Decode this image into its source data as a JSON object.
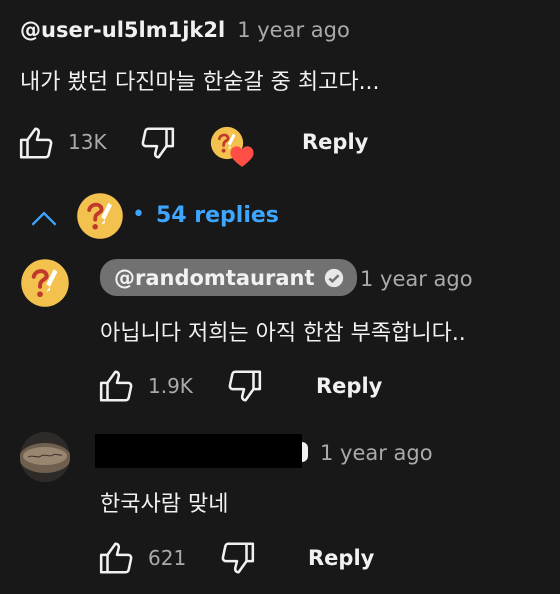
{
  "top_comment": {
    "author": "@user-ul5lm1jk2l",
    "timestamp": "1 year ago",
    "text": "내가 봤던 다진마늘 한숟갈 중 최고다...",
    "likes": "13K",
    "reply_label": "Reply",
    "hearted": true
  },
  "replies_toggle": {
    "bullet": "•",
    "label": "54 replies",
    "expanded": true
  },
  "replies": [
    {
      "author": "@randomtaurant",
      "verified": true,
      "timestamp": "1 year ago",
      "text": "아닙니다 저희는 아직 한참 부족합니다..",
      "likes": "1.9K",
      "reply_label": "Reply"
    },
    {
      "author_redacted": true,
      "timestamp": "1 year ago",
      "text": "한국사람 맞네",
      "likes": "621",
      "reply_label": "Reply"
    }
  ],
  "colors": {
    "background": "#181818",
    "link": "#3ea6ff",
    "heart": "#ff4e45",
    "logo_yellow": "#f2c14e",
    "logo_red": "#c0392b"
  }
}
